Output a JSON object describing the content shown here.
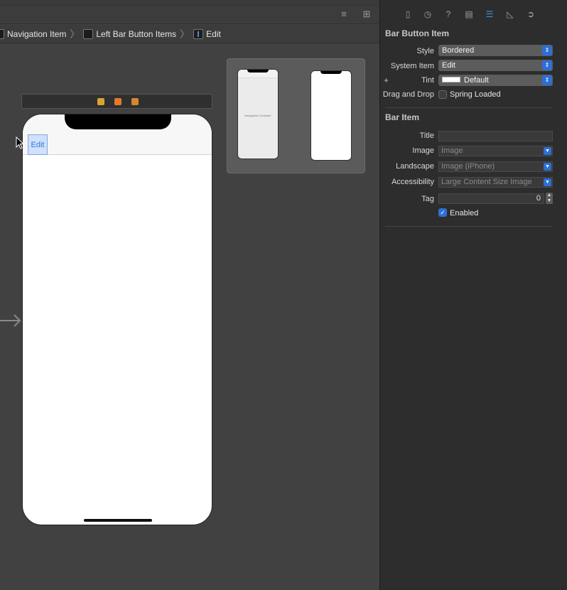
{
  "breadcrumb": {
    "items": [
      "Navigation Item",
      "Left Bar Button Items",
      "Edit"
    ]
  },
  "phone": {
    "edit_button": "Edit"
  },
  "minimap": {
    "nav_controller_label": "Navigation Controller"
  },
  "inspector": {
    "bar_button_item_title": "Bar Button Item",
    "style_label": "Style",
    "style_value": "Bordered",
    "system_item_label": "System Item",
    "system_item_value": "Edit",
    "tint_label": "Tint",
    "tint_value": "Default",
    "drag_drop_label": "Drag and Drop",
    "spring_loaded_label": "Spring Loaded",
    "bar_item_title": "Bar Item",
    "title_label": "Title",
    "title_value": "",
    "image_label": "Image",
    "image_placeholder": "Image",
    "landscape_label": "Landscape",
    "landscape_placeholder": "Image (iPhone)",
    "accessibility_label": "Accessibility",
    "accessibility_placeholder": "Large Content Size Image",
    "tag_label": "Tag",
    "tag_value": "0",
    "enabled_label": "Enabled",
    "spring_loaded_checked": false,
    "enabled_checked": true
  },
  "colors": {
    "accent": "#2d6fd6",
    "tab_active": "#3f8ef0",
    "edit_tint": "#2a7ae2"
  },
  "icons": {
    "tabs": [
      "file-icon",
      "history-icon",
      "help-icon",
      "identity-icon",
      "attributes-icon",
      "size-icon",
      "connections-icon"
    ]
  }
}
